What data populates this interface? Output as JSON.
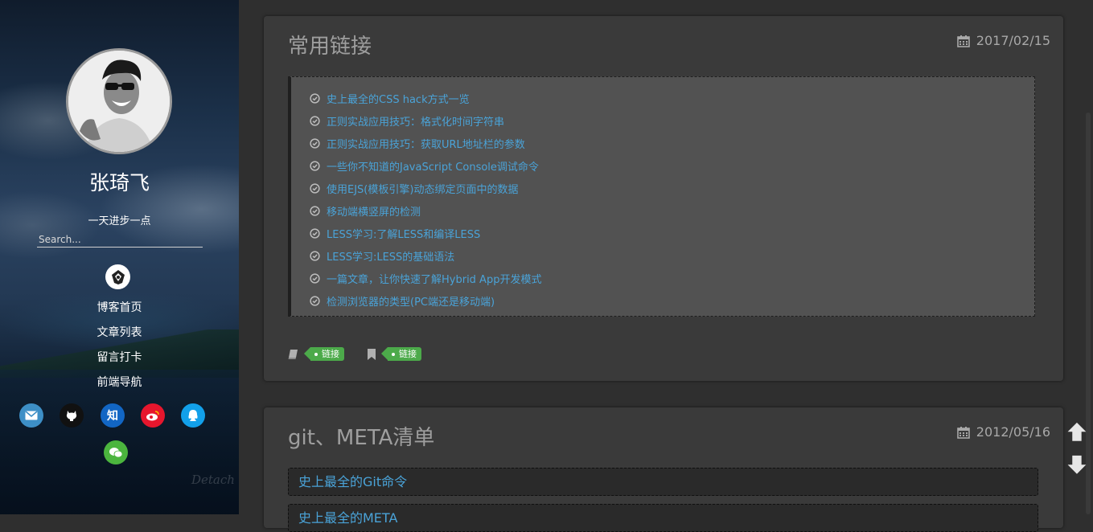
{
  "sidebar": {
    "author_name": "张琦飞",
    "motto": "一天进步一点",
    "search_placeholder": "Search...",
    "nav": [
      "博客首页",
      "文章列表",
      "留言打卡",
      "前端导航"
    ],
    "social": {
      "mail_icon": "mail-icon",
      "github_icon": "github-icon",
      "zhihu_label": "知",
      "weibo_icon": "weibo-icon",
      "qq_icon": "qq-icon",
      "wechat_icon": "wechat-icon"
    },
    "watermark": "Detach"
  },
  "posts": [
    {
      "title": "常用链接",
      "date": "2017/02/15",
      "links": [
        "史上最全的CSS hack方式一览",
        "正则实战应用技巧：格式化时间字符串",
        "正则实战应用技巧：获取URL地址栏的参数",
        "一些你不知道的JavaScript Console调试命令",
        "使用EJS(模板引擎)动态绑定页面中的数据",
        "移动端横竖屏的检测",
        "LESS学习:了解LESS和编译LESS",
        "LESS学习:LESS的基础语法",
        "一篇文章，让你快速了解Hybrid App开发模式",
        "检测浏览器的类型(PC端还是移动端)"
      ],
      "category_tag": "链接",
      "tag": "链接"
    },
    {
      "title": "git、META清单",
      "date": "2012/05/16",
      "links": [
        "史上最全的Git命令",
        "史上最全的META"
      ]
    }
  ],
  "colors": {
    "link": "#4aa3d8",
    "tag": "#4caa4a",
    "card": "#3a3a3a"
  }
}
